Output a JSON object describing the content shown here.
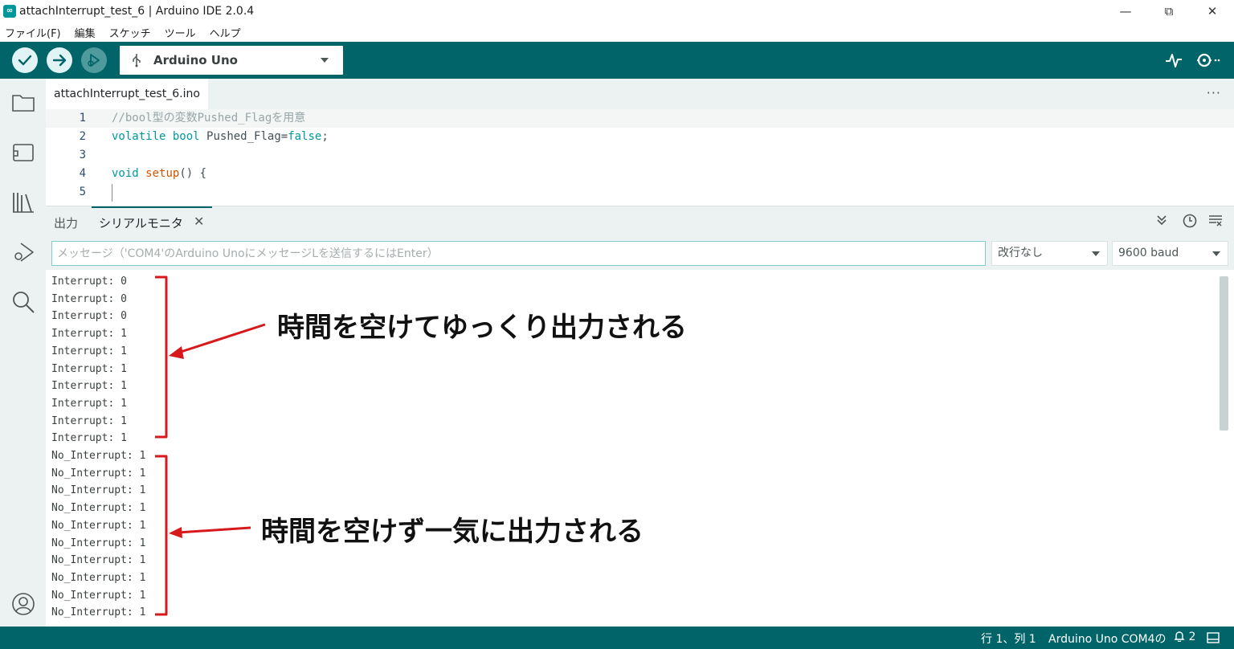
{
  "window": {
    "title": "attachInterrupt_test_6 | Arduino IDE 2.0.4",
    "app_icon": "∞",
    "minimize": "—",
    "restore": "⧉",
    "close": "✕"
  },
  "menu": [
    "ファイル(F)",
    "編集",
    "スケッチ",
    "ツール",
    "ヘルプ"
  ],
  "toolbar": {
    "board": "Arduino Uno",
    "usb_icon": "⚲"
  },
  "editor": {
    "tab_name": "attachInterrupt_test_6.ino",
    "more": "···",
    "lines": [
      {
        "n": "1",
        "text": "//bool型の変数Pushed_Flagを用意"
      },
      {
        "n": "2",
        "text": "volatile bool Pushed_Flag=false;"
      },
      {
        "n": "3",
        "text": ""
      },
      {
        "n": "4",
        "text": "void setup() {"
      },
      {
        "n": "5",
        "text": ""
      }
    ]
  },
  "panel": {
    "output_tab": "出力",
    "serial_tab": "シリアルモニタ",
    "close": "✕",
    "message_placeholder": "メッセージ（'COM4'のArduino UnoにメッセージLを送信するにはEnter）",
    "line_ending": "改行なし",
    "baud": "9600 baud"
  },
  "serial_output": [
    "Interrupt: 0",
    "Interrupt: 0",
    "Interrupt: 0",
    "Interrupt: 1",
    "Interrupt: 1",
    "Interrupt: 1",
    "Interrupt: 1",
    "Interrupt: 1",
    "Interrupt: 1",
    "Interrupt: 1",
    "No_Interrupt: 1",
    "No_Interrupt: 1",
    "No_Interrupt: 1",
    "No_Interrupt: 1",
    "No_Interrupt: 1",
    "No_Interrupt: 1",
    "No_Interrupt: 1",
    "No_Interrupt: 1",
    "No_Interrupt: 1",
    "No_Interrupt: 1"
  ],
  "annotations": {
    "first": "時間を空けてゆっくり出力される",
    "second": "時間を空けず一気に出力される",
    "color": "#d7191c"
  },
  "status": {
    "position": "行 1、列 1",
    "board_port": "Arduino Uno COM4の",
    "notifications": "2"
  },
  "colors": {
    "teal": "#006468",
    "panel_bg": "#ecf1f1"
  }
}
